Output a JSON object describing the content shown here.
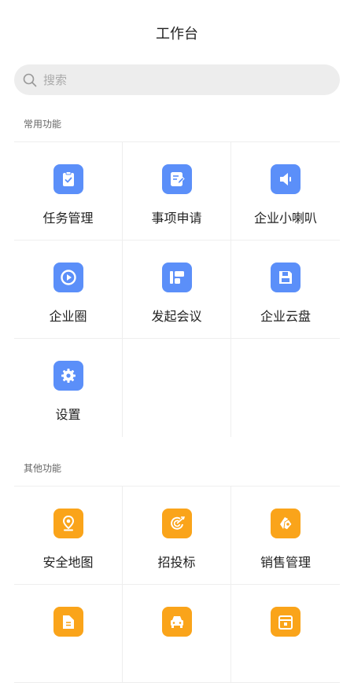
{
  "header": {
    "title": "工作台"
  },
  "search": {
    "placeholder": "搜索"
  },
  "common": {
    "title": "常用功能",
    "items": [
      {
        "label": "任务管理",
        "icon": "clipboard-check-icon",
        "color": "#5b8ff9"
      },
      {
        "label": "事项申请",
        "icon": "document-edit-icon",
        "color": "#5b8ff9"
      },
      {
        "label": "企业小喇叭",
        "icon": "speaker-icon",
        "color": "#5b8ff9"
      },
      {
        "label": "企业圈",
        "icon": "play-circle-icon",
        "color": "#5b8ff9"
      },
      {
        "label": "发起会议",
        "icon": "meeting-icon",
        "color": "#5b8ff9"
      },
      {
        "label": "企业云盘",
        "icon": "floppy-disk-icon",
        "color": "#5b8ff9"
      },
      {
        "label": "设置",
        "icon": "gear-icon",
        "color": "#5b8ff9"
      }
    ]
  },
  "other": {
    "title": "其他功能",
    "items": [
      {
        "label": "安全地图",
        "icon": "map-pin-icon",
        "color": "#faa41a"
      },
      {
        "label": "招投标",
        "icon": "bid-target-icon",
        "color": "#faa41a"
      },
      {
        "label": "销售管理",
        "icon": "price-tag-icon",
        "color": "#faa41a"
      },
      {
        "label": "",
        "icon": "file-icon",
        "color": "#faa41a"
      },
      {
        "label": "",
        "icon": "car-icon",
        "color": "#faa41a"
      },
      {
        "label": "",
        "icon": "calendar-icon",
        "color": "#faa41a"
      }
    ]
  }
}
